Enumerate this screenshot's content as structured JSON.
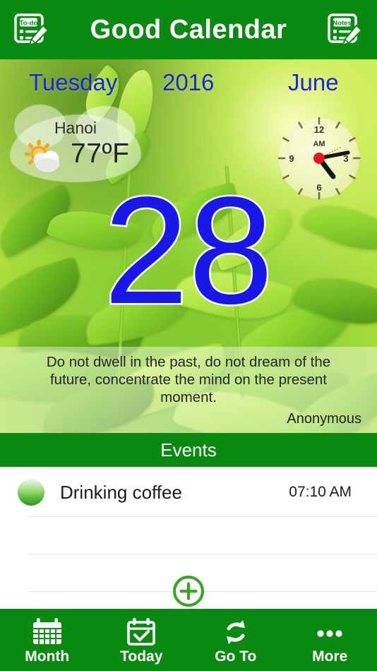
{
  "header": {
    "title": "Good Calendar",
    "left_icon": "todo-icon",
    "left_icon_label": "To-do",
    "right_icon": "notes-icon",
    "right_icon_label": "Notes"
  },
  "hero": {
    "weekday": "Tuesday",
    "year": "2016",
    "month": "June",
    "day_number": "28",
    "weather": {
      "city": "Hanoi",
      "temperature": "77ºF",
      "condition_icon": "sun-behind-cloud-icon"
    },
    "clock": {
      "meridiem": "AM",
      "numerals": [
        "12",
        "3",
        "6",
        "9"
      ],
      "hour_angle": 130,
      "minute_angle": 70,
      "second_angle": 100
    },
    "quote": {
      "text": "Do not dwell in the past, do not dream of the future, concentrate the mind on the present moment.",
      "author": "Anonymous"
    }
  },
  "events": {
    "section_title": "Events",
    "items": [
      {
        "title": "Drinking coffee",
        "time": "07:10 AM",
        "dot_color": "#4cb331"
      }
    ],
    "add_label": "add-event"
  },
  "tabbar": {
    "items": [
      {
        "label": "Month",
        "icon": "calendar-grid-icon"
      },
      {
        "label": "Today",
        "icon": "calendar-check-icon"
      },
      {
        "label": "Go To",
        "icon": "refresh-arrows-icon"
      },
      {
        "label": "More",
        "icon": "ellipsis-icon"
      }
    ]
  },
  "colors": {
    "brand_green": "#0b8a11",
    "accent_blue": "#1a18e8",
    "add_green": "#3aa528"
  }
}
